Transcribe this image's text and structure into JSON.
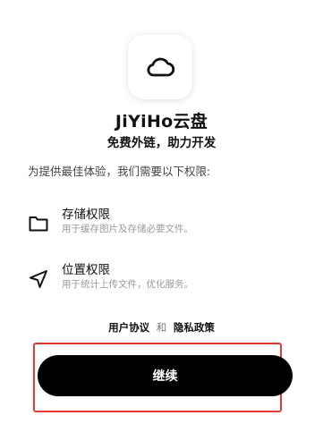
{
  "app": {
    "icon": "cloud-icon",
    "name": "JiYiHo云盘",
    "tagline": "免费外链，助力开发"
  },
  "permissions": {
    "intro": "为提供最佳体验，我们需要以下权限:",
    "items": [
      {
        "icon": "folder-icon",
        "title": "存储权限",
        "description": "用于缓存图片及存储必要文件。"
      },
      {
        "icon": "location-arrow-icon",
        "title": "位置权限",
        "description": "用于统计上传文件，优化服务。"
      }
    ]
  },
  "agreements": {
    "user_agreement": "用户协议",
    "and": "和",
    "privacy_policy": "隐私政策"
  },
  "actions": {
    "continue_label": "继续"
  },
  "colors": {
    "button_background": "#000000",
    "button_text": "#ffffff",
    "highlight_outline": "#e53935"
  }
}
